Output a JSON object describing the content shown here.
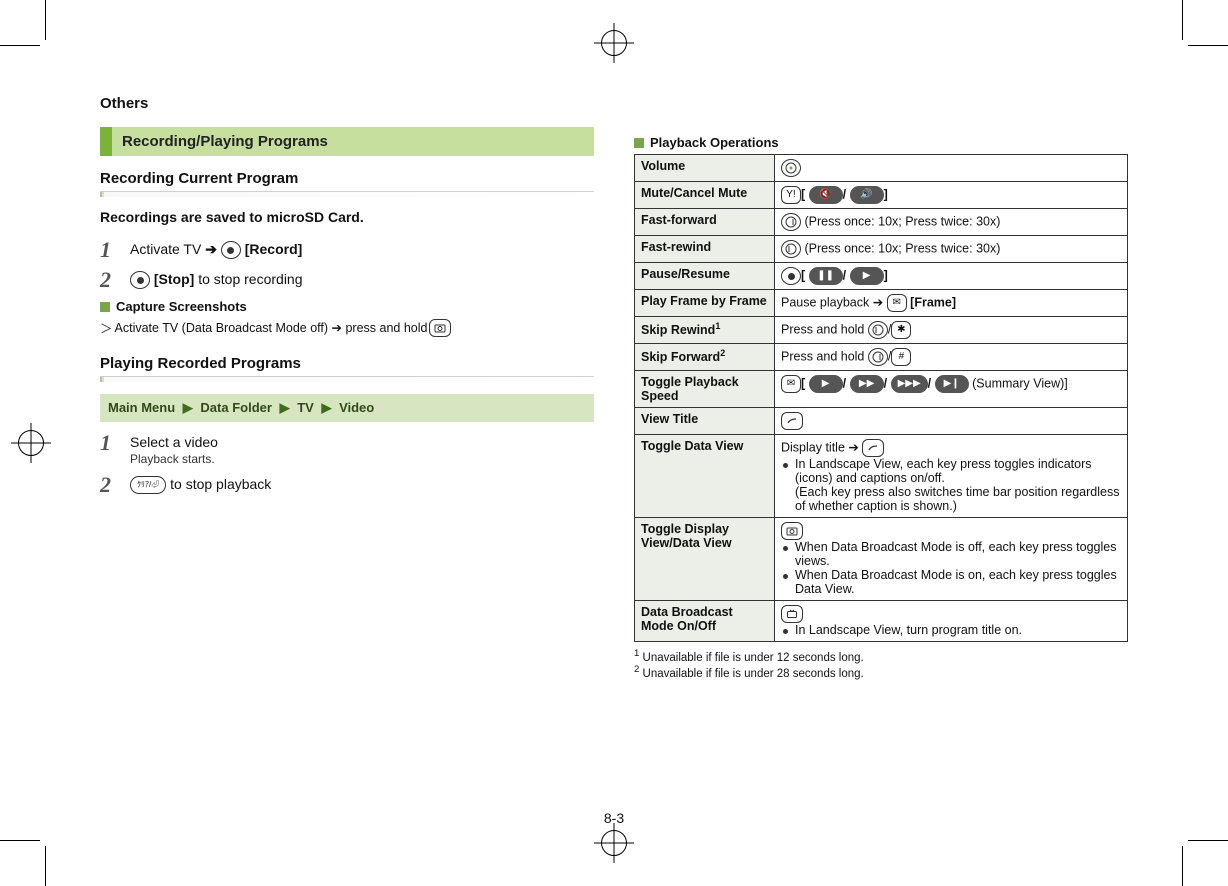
{
  "page_header": "Others",
  "page_number": "8-3",
  "left": {
    "banner": "Recording/Playing Programs",
    "h2a": "Recording Current Program",
    "note_a": "Recordings are saved to microSD Card.",
    "step1a_pre": "Activate TV ",
    "step1a_btn": "[Record]",
    "step2a_btn": "[Stop]",
    "step2a_post": " to stop recording",
    "sub_a": "Capture Screenshots",
    "sub_a_line": "Activate TV (Data Broadcast Mode off) ➔ press and hold ",
    "h2b": "Playing Recorded Programs",
    "menu": {
      "a": "Main Menu",
      "b": "Data Folder",
      "c": "TV",
      "d": "Video"
    },
    "step1b": "Select a video",
    "step1b_sub": "Playback starts.",
    "step2b_post": " to stop playback",
    "clear_key": "ｸﾘｱ/⏎"
  },
  "right": {
    "sub": "Playback Operations",
    "rows": {
      "volume": "Volume",
      "mute": "Mute/Cancel Mute",
      "ff": "Fast-forward",
      "fr": "Fast-rewind",
      "pr": "Pause/Resume",
      "frame": "Play Frame by Frame",
      "skr": "Skip Rewind",
      "skf": "Skip Forward",
      "tps": "Toggle Playback Speed",
      "vt": "View Title",
      "tdv": "Toggle Data View",
      "tdisp": "Toggle Display View/Data View",
      "dbm": "Data Broadcast Mode On/Off"
    },
    "vals": {
      "ff": " (Press once: 10x; Press twice: 30x)",
      "fr": " (Press once: 10x; Press twice: 30x)",
      "frame_pre": "Pause playback ➔ ",
      "frame_btn": "[Frame]",
      "skr": "Press and hold ",
      "skf": "Press and hold ",
      "tps_suffix": "(Summary View)]",
      "tdv_pre": "Display title ➔ ",
      "tdv_b1a": "In Landscape View, each key press toggles indicators (icons) and captions on/off.",
      "tdv_b1b": "(Each key press also switches time bar position regardless of whether caption is shown.)",
      "tdisp_b1": "When Data Broadcast Mode is off, each key press toggles views.",
      "tdisp_b2": "When Data Broadcast Mode is on, each key press toggles Data View.",
      "dbm_b1": "In Landscape View, turn program title on."
    },
    "fn1_sup": "1",
    "fn2_sup": "2",
    "fn1": "Unavailable if file is under 12 seconds long.",
    "fn2": "Unavailable if file is under 28 seconds long."
  }
}
